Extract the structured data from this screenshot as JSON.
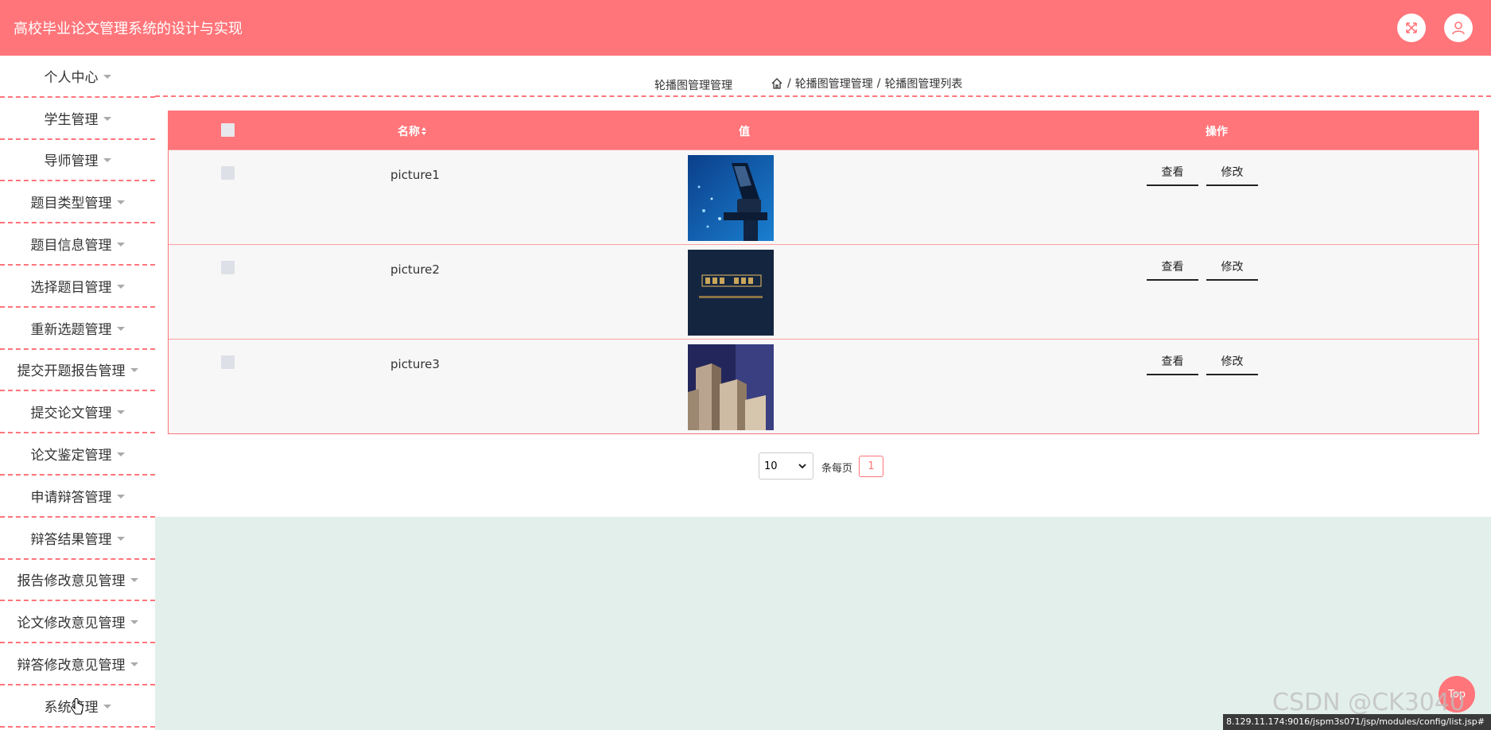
{
  "app": {
    "title": "高校毕业论文管理系统的设计与实现"
  },
  "header": {
    "fullscreen_icon": "fullscreen-expand-icon",
    "user_icon": "user-icon"
  },
  "sidebar": {
    "items": [
      {
        "label": "个人中心"
      },
      {
        "label": "学生管理"
      },
      {
        "label": "导师管理"
      },
      {
        "label": "题目类型管理"
      },
      {
        "label": "题目信息管理"
      },
      {
        "label": "选择题目管理"
      },
      {
        "label": "重新选题管理"
      },
      {
        "label": "提交开题报告管理"
      },
      {
        "label": "提交论文管理"
      },
      {
        "label": "论文鉴定管理"
      },
      {
        "label": "申请辩答管理"
      },
      {
        "label": "辩答结果管理"
      },
      {
        "label": "报告修改意见管理"
      },
      {
        "label": "论文修改意见管理"
      },
      {
        "label": "辩答修改意见管理"
      },
      {
        "label": "系统管理"
      }
    ]
  },
  "breadcrumb": {
    "title": "轮播图管理管理",
    "sep": "/",
    "level1": "轮播图管理管理",
    "level2": "轮播图管理列表"
  },
  "table": {
    "headers": {
      "name": "名称",
      "value": "值",
      "actions": "操作"
    },
    "rows": [
      {
        "name": "picture1",
        "image": "microscope",
        "view": "查看",
        "edit": "修改"
      },
      {
        "name": "picture2",
        "image": "library-sign",
        "view": "查看",
        "edit": "修改"
      },
      {
        "name": "picture3",
        "image": "bookshelves",
        "view": "查看",
        "edit": "修改"
      }
    ]
  },
  "pagination": {
    "page_size": "10",
    "per_page_label": "条每页",
    "current_page": "1"
  },
  "top_button": "Top",
  "watermark": "CSDN @CK3040",
  "status_url": "8.129.11.174:9016/jspm3s071/jsp/modules/config/list.jsp#",
  "colors": {
    "accent": "#ff757a",
    "content_bg": "#e3efeb"
  }
}
